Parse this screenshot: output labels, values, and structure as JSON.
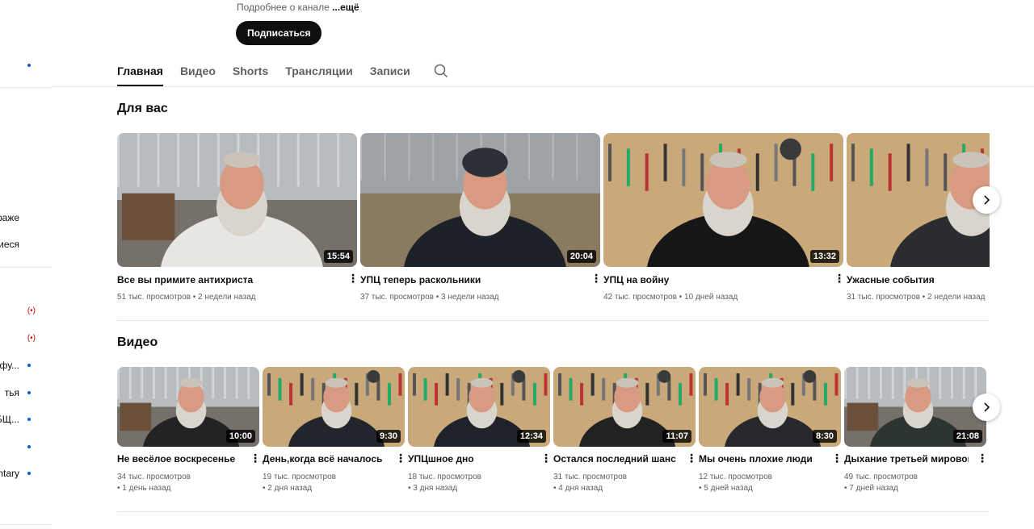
{
  "channel": {
    "description_prefix": "Подробнее о канале",
    "description_more": "...ещё",
    "subscribe_label": "Подписаться"
  },
  "sidebar": {
    "items": [
      {
        "label": "",
        "dot": true
      },
      {
        "label": "раже",
        "dot": false
      },
      {
        "label": "иеся",
        "dot": false
      },
      {
        "label": "",
        "live": true
      },
      {
        "label": "",
        "live": true
      },
      {
        "label": "й фу...",
        "dot": true
      },
      {
        "label": "тья",
        "dot": true
      },
      {
        "label": "БЩ...",
        "dot": true
      },
      {
        "label": "",
        "dot": true
      },
      {
        "label": "ntary",
        "dot": true
      }
    ],
    "live_icon": "(•)"
  },
  "tabs": [
    {
      "label": "Главная",
      "active": true
    },
    {
      "label": "Видео",
      "active": false
    },
    {
      "label": "Shorts",
      "active": false
    },
    {
      "label": "Трансляции",
      "active": false
    },
    {
      "label": "Записи",
      "active": false
    }
  ],
  "sections": {
    "for_you": {
      "title": "Для вас",
      "videos": [
        {
          "title": "Все вы примите антихриста",
          "duration": "15:54",
          "meta": "51 тыс. просмотров • 2 недели назад",
          "scene": "garage-white",
          "shirt": "#e8e6e2",
          "hat": false
        },
        {
          "title": "УПЦ теперь раскольники",
          "duration": "20:04",
          "meta": "37 тыс. просмотров • 3 недели назад",
          "scene": "workshop",
          "shirt": "#1d2128",
          "hat": true
        },
        {
          "title": "УПЦ на войну",
          "duration": "13:32",
          "meta": "42 тыс. просмотров • 10 дней назад",
          "scene": "tools",
          "shirt": "#161616",
          "hat": false
        },
        {
          "title": "Ужасные события",
          "duration": "",
          "meta": "31 тыс. просмотров • 2 недели назад",
          "scene": "tools",
          "shirt": "#2a2c30",
          "hat": false
        }
      ]
    },
    "videos": {
      "title": "Видео",
      "videos": [
        {
          "title": "Не весёлое воскресенье",
          "duration": "10:00",
          "meta1": "34 тыс. просмотров",
          "meta2": "• 1 день назад",
          "scene": "garage",
          "shirt": "#232325"
        },
        {
          "title": "День,когда всё началось",
          "duration": "9:30",
          "meta1": "19 тыс. просмотров",
          "meta2": "• 2 дня назад",
          "scene": "tools",
          "shirt": "#22252b"
        },
        {
          "title": "УПЦшное дно",
          "duration": "12:34",
          "meta1": "18 тыс. просмотров",
          "meta2": "• 3 дня назад",
          "scene": "tools",
          "shirt": "#1f2228"
        },
        {
          "title": "Остался последний шанс",
          "duration": "11:07",
          "meta1": "31 тыс. просмотров",
          "meta2": "• 4 дня назад",
          "scene": "tools",
          "shirt": "#222"
        },
        {
          "title": "Мы очень плохие люди",
          "duration": "8:30",
          "meta1": "12 тыс. просмотров",
          "meta2": "• 5 дней назад",
          "scene": "tools",
          "shirt": "#26282c"
        },
        {
          "title": "Дыхание третьей мировой",
          "duration": "21:08",
          "meta1": "49 тыс. просмотров",
          "meta2": "• 7 дней назад",
          "scene": "garage",
          "shirt": "#2c3530"
        }
      ]
    }
  },
  "colors": {
    "accent_dot": "#065fd4",
    "live": "#cc0000",
    "text_primary": "#0f0f0f",
    "text_secondary": "#606060"
  },
  "icons": {
    "kebab": "⋮",
    "chevron": "chevron-right-icon",
    "search": "search-icon"
  }
}
